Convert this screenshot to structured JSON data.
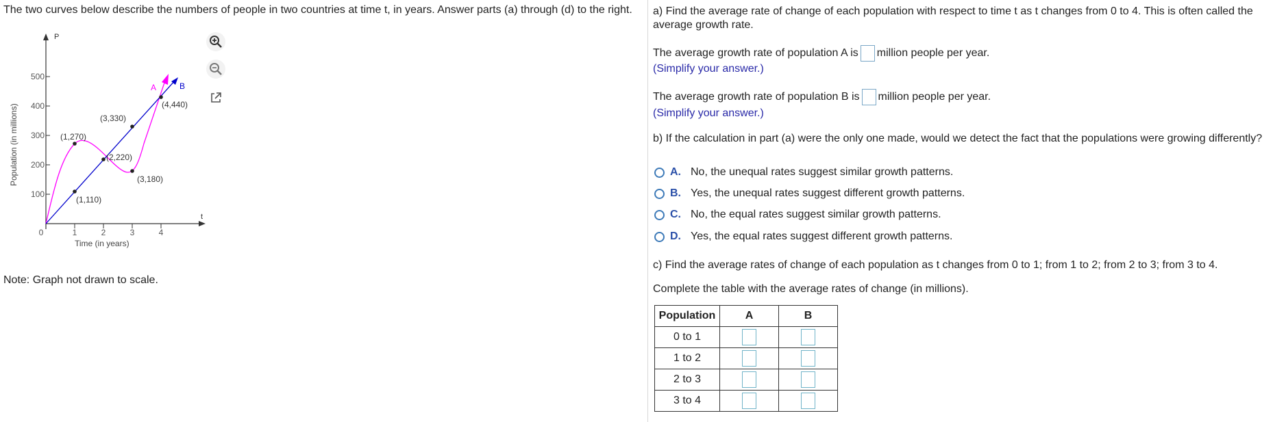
{
  "problem": {
    "intro": "The two curves below describe the numbers of people in two countries at time t, in years. Answer parts (a) through (d) to the right.",
    "note": "Note: Graph not drawn to scale."
  },
  "graph": {
    "p_label": "P",
    "t_label": "t",
    "ylabel": "Population (in millions)",
    "xlabel": "Time (in years)",
    "curve_a_label": "A",
    "curve_b_label": "B",
    "yticks": [
      "500",
      "400",
      "300",
      "200",
      "100"
    ],
    "xticks": [
      "0",
      "1",
      "2",
      "3",
      "4"
    ],
    "points": {
      "p1": "(1,270)",
      "p2": "(3,330)",
      "p3": "(2,220)",
      "p4": "(3,180)",
      "p5": "(1,110)",
      "p6": "(4,440)"
    },
    "colors": {
      "curve_a": "#ff00ff",
      "curve_b": "#0000cc"
    }
  },
  "tools": {
    "zoom_in": "zoom-in-icon",
    "zoom_out": "zoom-out-icon",
    "popout": "popout-icon"
  },
  "part_a": {
    "question": "a) Find the average rate of change of each population with respect to time t as t changes from 0 to 4. This is often called the average growth rate.",
    "line_a_pre": "The average growth rate of population A is",
    "line_b_pre": "The average growth rate of population B is",
    "line_post": "million people per year.",
    "hint": "(Simplify your answer.)"
  },
  "part_b": {
    "question": "b) If the calculation in part (a) were the only one made, would we detect the fact that the populations were growing differently?",
    "choices": [
      {
        "letter": "A.",
        "text": "No, the unequal rates suggest similar growth patterns."
      },
      {
        "letter": "B.",
        "text": "Yes, the unequal rates suggest different growth patterns."
      },
      {
        "letter": "C.",
        "text": "No, the equal rates suggest similar growth patterns."
      },
      {
        "letter": "D.",
        "text": "Yes, the equal rates suggest different growth patterns."
      }
    ]
  },
  "part_c": {
    "question": "c) Find the average rates of change of each population as t changes from 0 to 1; from 1 to 2; from 2 to 3; from 3 to 4.",
    "instruction": "Complete the table with the average rates of change (in millions).",
    "headers": [
      "Population",
      "A",
      "B"
    ],
    "rows": [
      "0 to 1",
      "1 to 2",
      "2 to 3",
      "3 to 4"
    ]
  }
}
